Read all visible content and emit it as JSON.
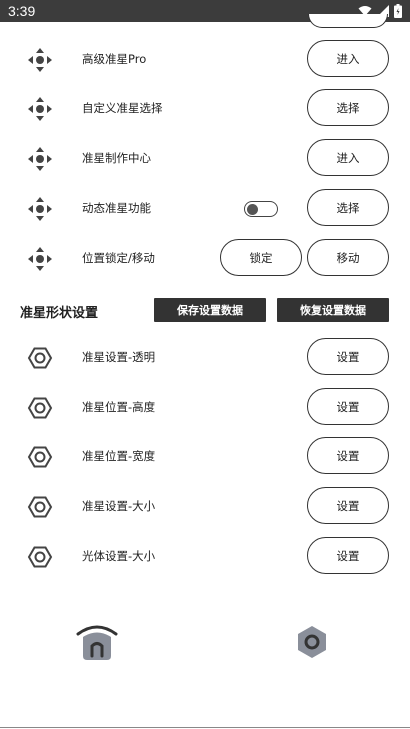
{
  "status_bar": {
    "time": "3:39"
  },
  "top_rows": [
    {
      "label": "高级准星Pro",
      "button": "进入"
    },
    {
      "label": "自定义准星选择",
      "button": "选择"
    },
    {
      "label": "准星制作中心",
      "button": "进入"
    },
    {
      "label": "动态准星功能",
      "button": "选择",
      "toggle_on": false
    },
    {
      "label": "位置锁定/移动",
      "buttons": [
        "锁定",
        "移动"
      ]
    }
  ],
  "section": {
    "title": "准星形状设置",
    "save_button": "保存设置数据",
    "restore_button": "恢复设置数据"
  },
  "settings_rows": [
    {
      "label": "准星设置-透明",
      "button": "设置"
    },
    {
      "label": "准星位置-高度",
      "button": "设置"
    },
    {
      "label": "准星位置-宽度",
      "button": "设置"
    },
    {
      "label": "准星设置-大小",
      "button": "设置"
    },
    {
      "label": "光体设置-大小",
      "button": "设置"
    }
  ],
  "colors": {
    "status_bar": "#3c3c3c",
    "dark_button": "#333333",
    "nav_icon": "#8a8f9a"
  },
  "icons": [
    "move-arrows-icon",
    "hexagon-nut-icon",
    "home-icon",
    "settings-hex-icon",
    "wifi-icon",
    "signal-icon",
    "battery-icon"
  ]
}
